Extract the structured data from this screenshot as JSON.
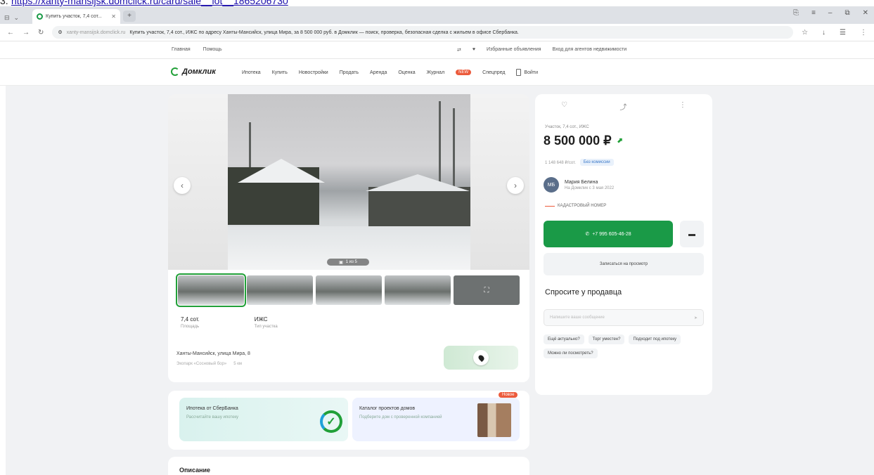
{
  "caption": {
    "prefix": "3.",
    "url": "https://xanty-mansijsk.domclick.ru/card/sale__lot__1865206730"
  },
  "browser": {
    "tab_title": "Купить участок, 7,4 сот...",
    "url_host": "xanty-mansijsk.domclick.ru",
    "url_title": "Купить участок, 7,4 сот., ИЖС по адресу Ханты-Мансийск, улица Мира, за 8 500 000 руб. в Домклик — поиск, проверка, безопасная сделка с жильем в офисе Сбербанка.",
    "win_controls": [
      "⎘",
      "≡",
      "–",
      "⧉",
      "✕"
    ],
    "bookmarks_left": [
      "Главная",
      "Помощь"
    ],
    "bookmarks_right": [
      "Избранные объявления",
      "Вход для агентов недвижимости"
    ]
  },
  "site": {
    "logo": "Домклик",
    "nav": [
      "Ипотека",
      "Купить",
      "Новостройки",
      "Продать",
      "Аренда",
      "Оценка",
      "Журнал",
      "Спецпред"
    ],
    "badge": "NEW",
    "login": "Войти"
  },
  "gallery": {
    "counter": "1 из 5"
  },
  "facts": [
    {
      "value": "7,4 сот.",
      "label": "Площадь"
    },
    {
      "value": "ИЖС",
      "label": "Тип участка"
    }
  ],
  "address": "Ханты-Мансийск, улица Мира, 8",
  "metro": [
    "Экопарк «Сосновый бор»",
    "5 км"
  ],
  "promo": {
    "a_title": "Ипотека от СберБанка",
    "a_sub": "Рассчитайте вашу ипотеку",
    "b_title": "Каталог проектов домов",
    "b_sub": "Подберите дом с проверенной компанией",
    "badge": "Новое"
  },
  "description_heading": "Описание",
  "side": {
    "type": "Участок, 7,4 сот., ИЖС",
    "price": "8 500 000 ₽",
    "per_unit": "1 148 648 ₽/сот.",
    "chip": "Без комиссии",
    "agent_initials": "МБ",
    "agent_name": "Мария Белина",
    "agent_sub": "На Домклик с 3 мая 2022",
    "cadastre": "КАДАСТРОВЫЙ НОМЕР",
    "phone": "+7 995 605-46-28",
    "visit": "Записаться на просмотр",
    "ask_heading": "Спросите у продавца",
    "ask_placeholder": "Напишите ваше сообщение",
    "questions": [
      "Ещё актуально?",
      "Торг уместен?",
      "Подходит под ипотеку",
      "Можно ли посмотреть?"
    ]
  }
}
